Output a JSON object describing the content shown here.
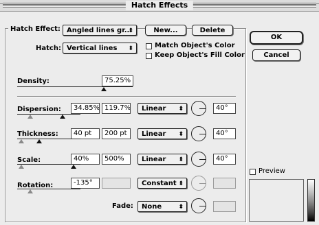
{
  "window": {
    "title": "Hatch Effects"
  },
  "hatch_effect": {
    "label": "Hatch Effect:",
    "value": "Angled lines gr...",
    "new_label": "New...",
    "delete_label": "Delete"
  },
  "hatch": {
    "label": "Hatch:",
    "value": "Vertical lines"
  },
  "options": {
    "match_color": "Match Object's Color",
    "keep_fill": "Keep Object's Fill Color"
  },
  "buttons": {
    "ok": "OK",
    "cancel": "Cancel"
  },
  "density": {
    "label": "Density:",
    "value": "75.25%",
    "slider_level": 0.7525
  },
  "dispersion": {
    "label": "Dispersion:",
    "min": "34.85%",
    "max": "119.7%",
    "mode": "Linear",
    "angle": "40°"
  },
  "thickness": {
    "label": "Thickness:",
    "min": "40 pt",
    "max": "200 pt",
    "mode": "Linear",
    "angle": "40°"
  },
  "scale": {
    "label": "Scale:",
    "min": "40%",
    "max": "500%",
    "mode": "Linear",
    "angle": "40°"
  },
  "rotation": {
    "label": "Rotation:",
    "min": "-135°",
    "max": "",
    "mode": "Constant",
    "angle": ""
  },
  "fade": {
    "label": "Fade:",
    "mode": "None",
    "angle": ""
  },
  "preview": {
    "label": "Preview"
  },
  "icons": {
    "popup_arrows": "updown-arrows-icon",
    "dial": "angle-dial-icon",
    "thumb": "slider-thumb-icon"
  }
}
